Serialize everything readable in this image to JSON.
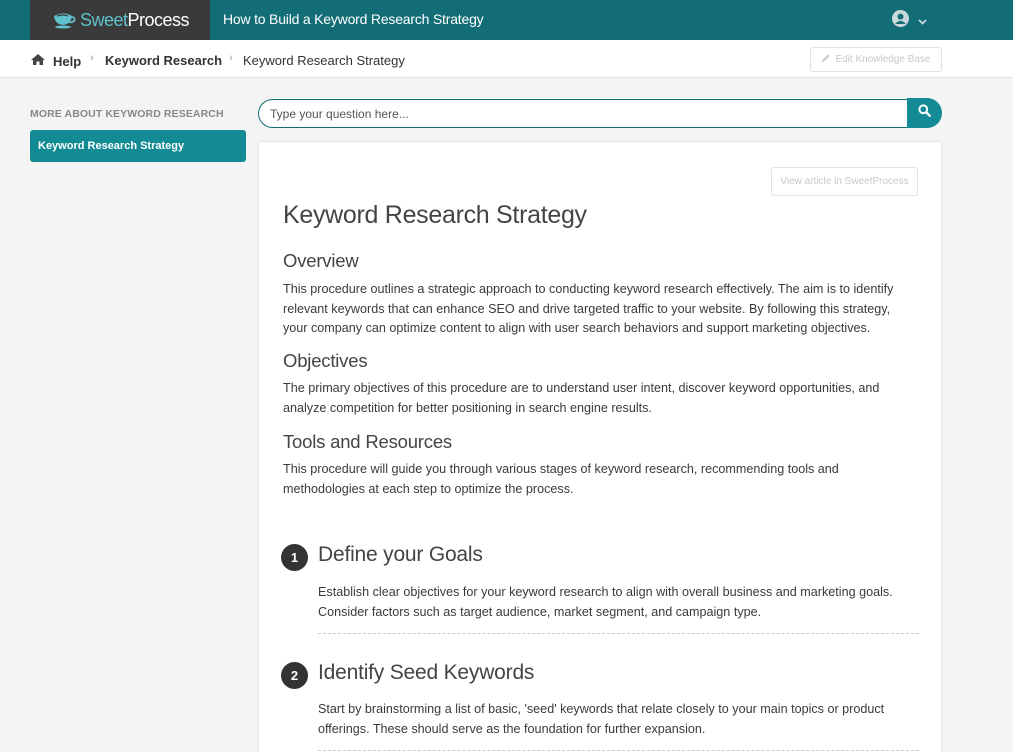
{
  "app": {
    "logo_part1": "Sweet",
    "logo_part2": "Process",
    "title": "How to Build a Keyword Research Strategy",
    "brand_color": "#136d77",
    "accent_color": "#138b95"
  },
  "user_menu": {
    "icon": "user-circle-icon",
    "caret": "chevron-down-icon"
  },
  "breadcrumb": {
    "home_label": "Help",
    "section_label": "Keyword Research",
    "current_label": "Keyword Research Strategy",
    "separator": "›"
  },
  "edit_button": {
    "label": "Edit Knowledge Base",
    "icon": "pencil-icon"
  },
  "sidebar": {
    "heading": "MORE ABOUT KEYWORD RESEARCH",
    "items": [
      {
        "label": "Keyword Research Strategy",
        "active": true
      }
    ]
  },
  "search": {
    "placeholder": "Type your question here...",
    "value": "",
    "icon": "search-icon"
  },
  "article": {
    "view_button_label": "View article in SweetProcess",
    "title": "Keyword Research Strategy",
    "sections": [
      {
        "heading": "Overview",
        "text": "This procedure outlines a strategic approach to conducting keyword research effectively. The aim is to identify relevant keywords that can enhance SEO and drive targeted traffic to your website. By following this strategy, your company can optimize content to align with user search behaviors and support marketing objectives."
      },
      {
        "heading": "Objectives",
        "text": "The primary objectives of this procedure are to understand user intent, discover keyword opportunities, and analyze competition for better positioning in search engine results."
      },
      {
        "heading": "Tools and Resources",
        "text": "This procedure will guide you through various stages of keyword research, recommending tools and methodologies at each step to optimize the process."
      }
    ],
    "steps": [
      {
        "number": "1",
        "title": "Define your Goals",
        "text": "Establish clear objectives for your keyword research to align with overall business and marketing goals. Consider factors such as target audience, market segment, and campaign type."
      },
      {
        "number": "2",
        "title": "Identify Seed Keywords",
        "text": "Start by brainstorming a list of basic, 'seed' keywords that relate closely to your main topics or product offerings. These should serve as the foundation for further expansion."
      }
    ]
  }
}
